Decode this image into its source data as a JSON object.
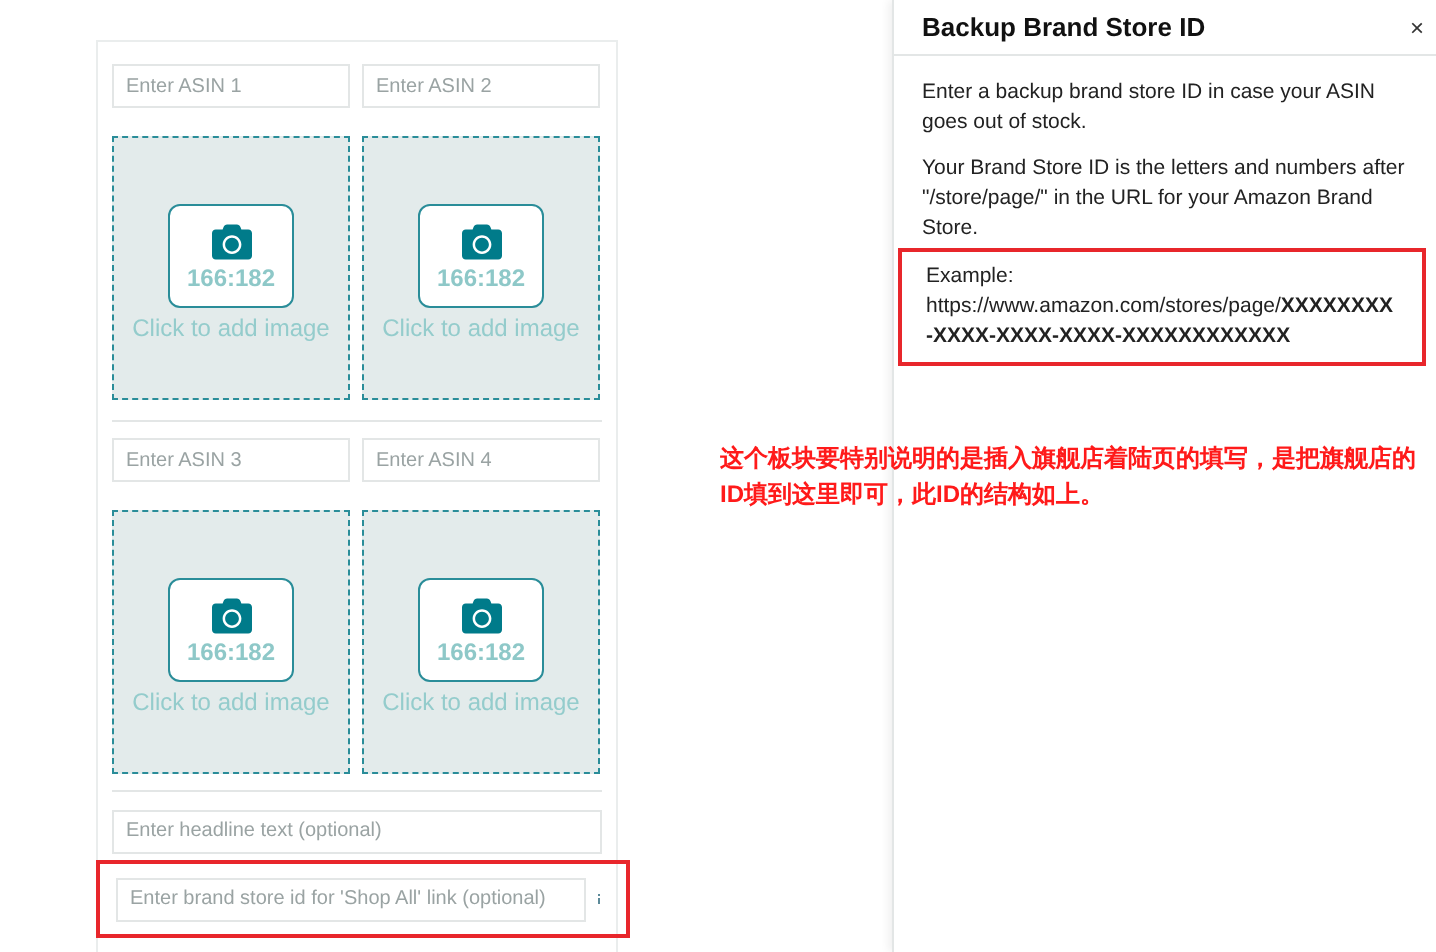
{
  "editor": {
    "groups": [
      {
        "asin_fields": [
          {
            "placeholder": "Enter ASIN 1"
          },
          {
            "placeholder": "Enter ASIN 2"
          }
        ],
        "tiles": [
          {
            "ratio": "166:182",
            "caption": "Click to add image"
          },
          {
            "ratio": "166:182",
            "caption": "Click to add image"
          }
        ]
      },
      {
        "asin_fields": [
          {
            "placeholder": "Enter ASIN 3"
          },
          {
            "placeholder": "Enter ASIN 4"
          }
        ],
        "tiles": [
          {
            "ratio": "166:182",
            "caption": "Click to add image"
          },
          {
            "ratio": "166:182",
            "caption": "Click to add image"
          }
        ]
      }
    ],
    "headline_field": {
      "placeholder": "Enter headline text (optional)"
    },
    "store_id_field": {
      "placeholder": "Enter brand store id for 'Shop All' link (optional)",
      "highlighted": true
    }
  },
  "help_panel": {
    "title": "Backup Brand Store ID",
    "close": "×",
    "paragraphs": [
      "Enter a backup brand store ID in case your ASIN goes out of stock.",
      "Your Brand Store ID is the letters and numbers after \"/store/page/\" in the URL for your Amazon Brand Store."
    ],
    "example": {
      "label": "Example:",
      "url": "https://www.amazon.com/stores/page/**XXXXXXXX-XXXX-XXXX-XXXX-XXXXXXXXXXXX**",
      "highlighted": true
    }
  },
  "annotation": "这个板块要特别说明的是插入旗舰店着陆页的填写，是把旗舰店的ID填到这里即可，此ID的结构如上。"
}
